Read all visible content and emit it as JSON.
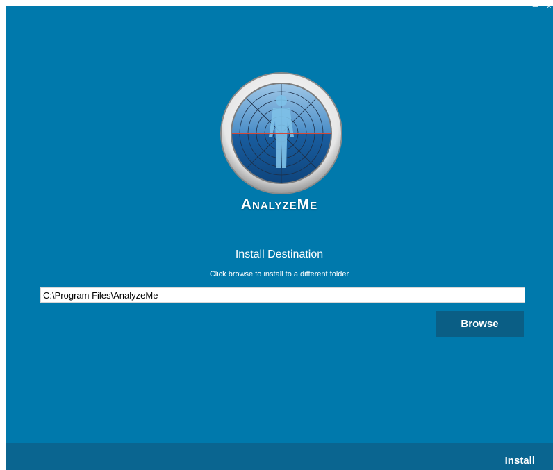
{
  "window": {
    "minimize_glyph": "–",
    "close_glyph": "×",
    "background_color": "#0079ac"
  },
  "logo": {
    "icon": "radar-human-figure-icon",
    "brand_text": "AnalyzeMe"
  },
  "destination": {
    "title": "Install Destination",
    "subtitle": "Click browse to install to a different folder",
    "path_value": "C:\\Program Files\\AnalyzeMe"
  },
  "buttons": {
    "browse_label": "Browse",
    "install_label": "Install"
  },
  "colors": {
    "footer": "#0a6590",
    "browse_button": "#0a5e85",
    "horizon_line": "#d24a3a"
  }
}
